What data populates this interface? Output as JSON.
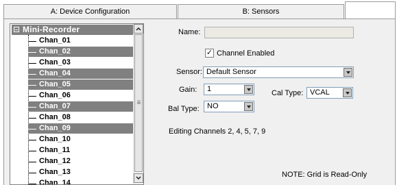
{
  "tabs": [
    {
      "label": "A: Device Configuration"
    },
    {
      "label": "B: Sensors"
    },
    {
      "label": ""
    }
  ],
  "tree": {
    "root": "Mini-Recorder",
    "items": [
      {
        "label": "Chan_01",
        "selected": false
      },
      {
        "label": "Chan_02",
        "selected": true
      },
      {
        "label": "Chan_03",
        "selected": false
      },
      {
        "label": "Chan_04",
        "selected": true
      },
      {
        "label": "Chan_05",
        "selected": true
      },
      {
        "label": "Chan_06",
        "selected": false
      },
      {
        "label": "Chan_07",
        "selected": true
      },
      {
        "label": "Chan_08",
        "selected": false
      },
      {
        "label": "Chan_09",
        "selected": true
      },
      {
        "label": "Chan_10",
        "selected": false
      },
      {
        "label": "Chan_11",
        "selected": false
      },
      {
        "label": "Chan_12",
        "selected": false
      },
      {
        "label": "Chan_13",
        "selected": false
      },
      {
        "label": "Chan_14",
        "selected": false
      }
    ]
  },
  "form": {
    "name_label": "Name:",
    "name_value": "",
    "channel_enabled_label": "Channel Enabled",
    "channel_enabled_checked": true,
    "sensor_label": "Sensor:",
    "sensor_value": "Default Sensor",
    "gain_label": "Gain:",
    "gain_value": "1",
    "cal_type_label": "Cal Type:",
    "cal_type_value": "VCAL",
    "bal_type_label": "Bal Type:",
    "bal_type_value": "NO",
    "editing_text": "Editing Channels 2, 4, 5, 7, 9",
    "note_text": "NOTE: Grid is Read-Only"
  },
  "icons": {
    "collapse": "minus-box-icon",
    "dropdown": "chevron-down-icon",
    "check": "✓"
  }
}
